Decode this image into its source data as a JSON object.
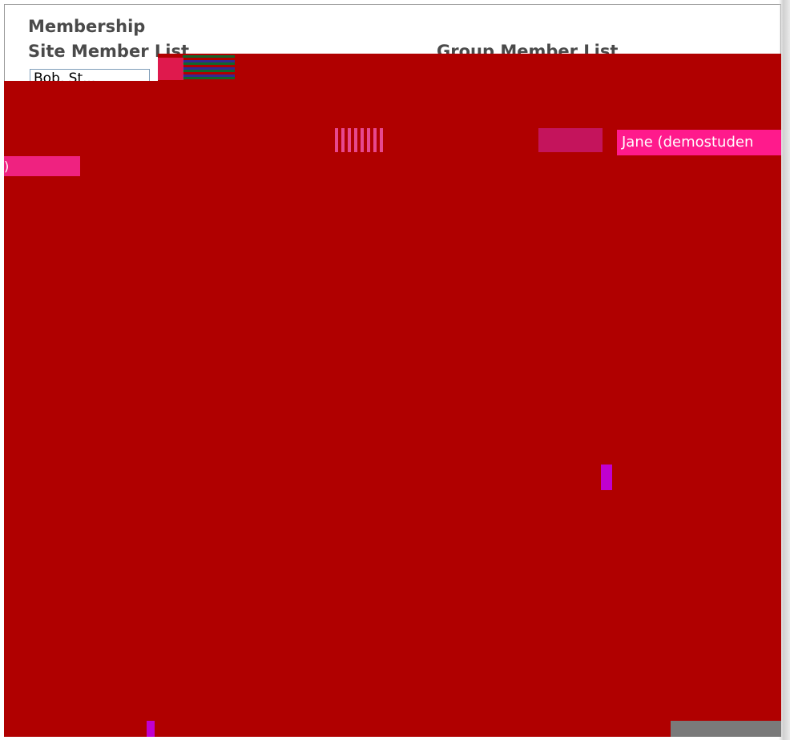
{
  "titles": {
    "membership": "Membership",
    "site_member_list": "Site Member List",
    "group_member_list": "Group Member List"
  },
  "site_member_select": {
    "selected": "Bob, St..."
  },
  "group_member_item": {
    "text": "Jane (demostuden",
    "trailing": ")"
  }
}
